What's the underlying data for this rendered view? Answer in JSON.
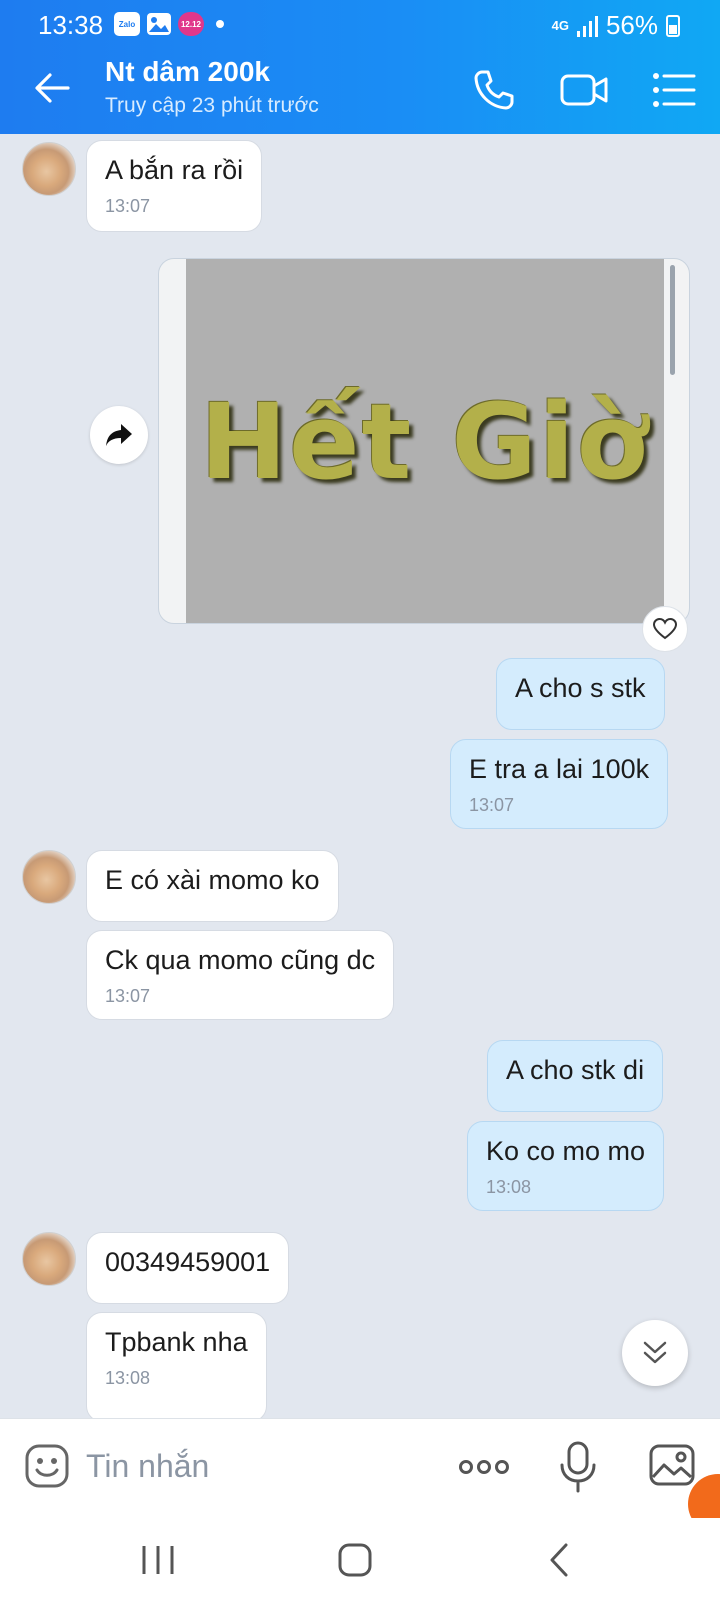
{
  "status_bar": {
    "time": "13:38",
    "notif_icons": [
      "zalo-icon",
      "gallery-icon",
      "sale-icon"
    ],
    "zalo_label": "Zalo",
    "sale_label": "12.12",
    "network": "4G",
    "battery": "56%"
  },
  "header": {
    "contact_name": "Nt dâm 200k",
    "contact_status": "Truy cập 23 phút trước",
    "icons": [
      "back-arrow-icon",
      "phone-icon",
      "video-call-icon",
      "list-menu-icon"
    ]
  },
  "messages": [
    {
      "side": "in",
      "text": "A bắn ra rồi",
      "time": "13:07"
    },
    {
      "side": "in",
      "type": "image",
      "image_text": "Hết Giờ"
    },
    {
      "side": "out",
      "text": "A cho s stk"
    },
    {
      "side": "out",
      "text": "E tra a lai 100k",
      "time": "13:07"
    },
    {
      "side": "in",
      "text": "E có xài momo ko"
    },
    {
      "side": "in",
      "text": "Ck qua momo cũng dc",
      "time": "13:07"
    },
    {
      "side": "out",
      "text": "A cho stk di"
    },
    {
      "side": "out",
      "text": "Ko co mo mo",
      "time": "13:08"
    },
    {
      "side": "in",
      "text": "00349459001"
    },
    {
      "side": "in",
      "text": "Tpbank nha",
      "time": "13:08"
    }
  ],
  "input_bar": {
    "placeholder": "Tin nhắn",
    "icons": [
      "sticker-icon",
      "more-dots-icon",
      "microphone-icon",
      "image-icon"
    ]
  },
  "nav_bar": {
    "icons": [
      "recent-apps-icon",
      "home-icon",
      "back-icon"
    ]
  },
  "colors": {
    "header_start": "#1e7cf0",
    "header_end": "#10a8f4",
    "chat_bg": "#e2e7ef",
    "outgoing_bubble": "#d4ecfd",
    "incoming_bubble": "#ffffff"
  }
}
